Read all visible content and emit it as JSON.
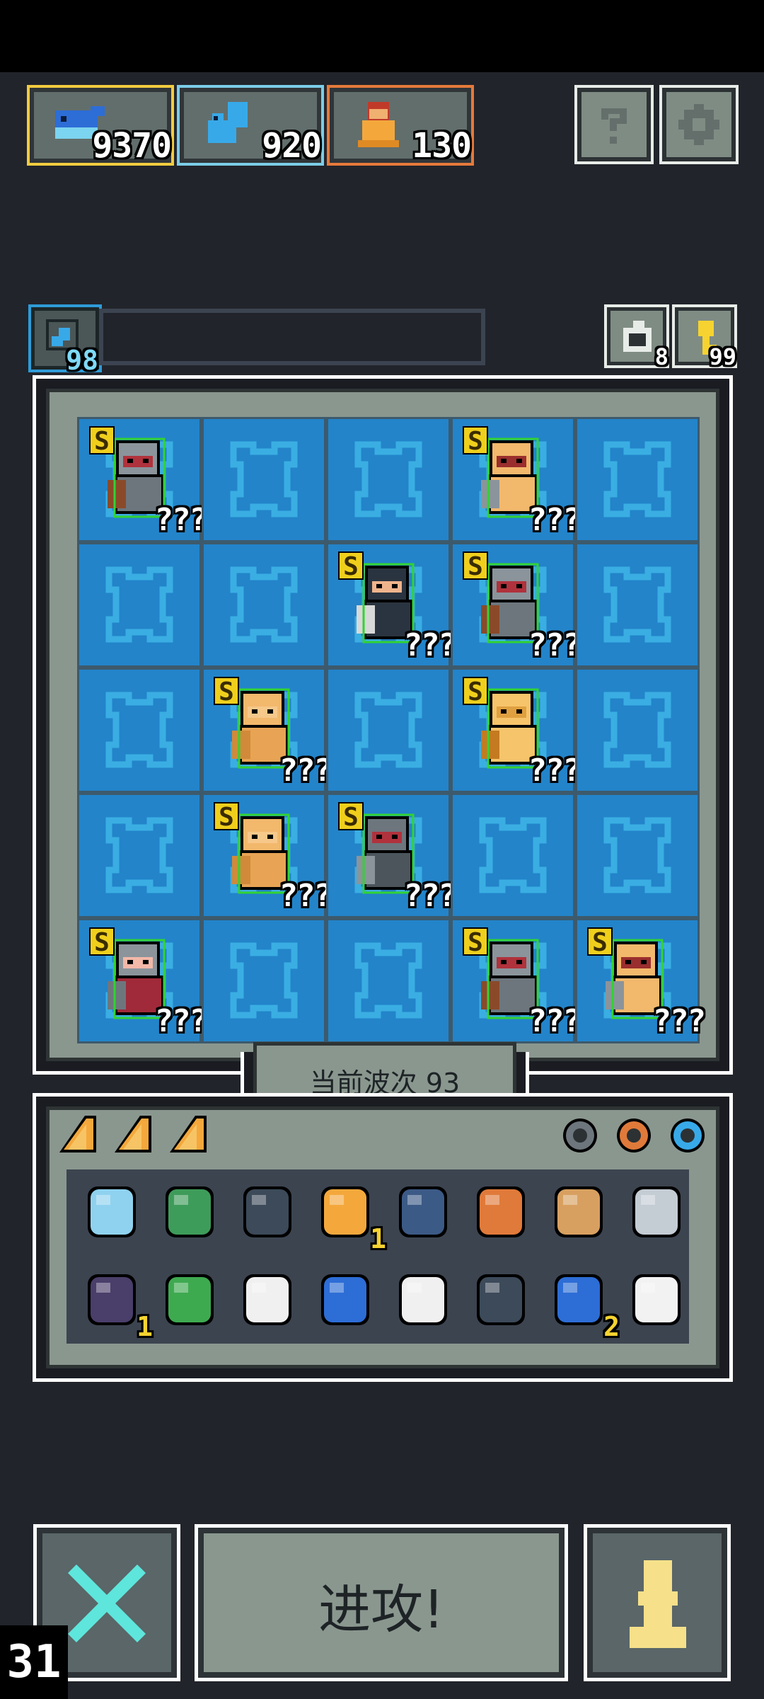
{
  "resources": [
    {
      "icon": "blue-fish-icon",
      "value": "9370",
      "border": "#f2cc40"
    },
    {
      "icon": "blue-squirrel-icon",
      "value": "920",
      "border": "#7ccde8"
    },
    {
      "icon": "orange-pawn-icon",
      "value": "130",
      "border": "#e57a3b"
    }
  ],
  "buttons": {
    "help_icon": "question-icon",
    "settings_icon": "gear-icon"
  },
  "skill": {
    "value": "98",
    "accent": "#2e9bd8"
  },
  "refresh": {
    "value": "8"
  },
  "keys": {
    "value": "99"
  },
  "board": {
    "columns": 5,
    "rows": 5,
    "units": [
      {
        "row": 0,
        "col": 0,
        "rank": "S",
        "label": "???",
        "kind": "shield-knight-icon"
      },
      {
        "row": 0,
        "col": 3,
        "rank": "S",
        "label": "???",
        "kind": "red-scarf-warrior-icon"
      },
      {
        "row": 1,
        "col": 2,
        "rank": "S",
        "label": "???",
        "kind": "dark-hood-rogue-icon"
      },
      {
        "row": 1,
        "col": 3,
        "rank": "S",
        "label": "???",
        "kind": "shield-knight-icon"
      },
      {
        "row": 2,
        "col": 1,
        "rank": "S",
        "label": "???",
        "kind": "golden-golem-icon"
      },
      {
        "row": 2,
        "col": 3,
        "rank": "S",
        "label": "???",
        "kind": "golden-paladin-icon"
      },
      {
        "row": 3,
        "col": 1,
        "rank": "S",
        "label": "???",
        "kind": "golden-golem-icon"
      },
      {
        "row": 3,
        "col": 2,
        "rank": "S",
        "label": "???",
        "kind": "iron-knight-icon"
      },
      {
        "row": 4,
        "col": 0,
        "rank": "S",
        "label": "???",
        "kind": "spear-maiden-icon"
      },
      {
        "row": 4,
        "col": 3,
        "rank": "S",
        "label": "???",
        "kind": "shield-knight-icon"
      },
      {
        "row": 4,
        "col": 4,
        "rank": "S",
        "label": "???",
        "kind": "red-scarf-warrior-icon"
      }
    ]
  },
  "wave": {
    "label": "当前波次 93"
  },
  "inventory": {
    "cheese": [
      "cheese-icon",
      "cheese-icon",
      "cheese-icon"
    ],
    "relics": [
      "armor-relic-icon",
      "ring-relic-icon",
      "blue-ring-relic-icon"
    ],
    "items": [
      {
        "icon": "mirror-scroll-icon",
        "count": ""
      },
      {
        "icon": "turtle-shell-icon",
        "count": ""
      },
      {
        "icon": "shield-icon",
        "count": ""
      },
      {
        "icon": "orange-pawn-icon",
        "count": "1"
      },
      {
        "icon": "stone-rubble-icon",
        "count": ""
      },
      {
        "icon": "wooden-staff-icon",
        "count": ""
      },
      {
        "icon": "ship-icon",
        "count": ""
      },
      {
        "icon": "battle-axe-icon",
        "count": ""
      },
      {
        "icon": "dark-tree-icon",
        "count": "1"
      },
      {
        "icon": "grass-icon",
        "count": ""
      },
      {
        "icon": "feather-icon",
        "count": ""
      },
      {
        "icon": "potion-icon",
        "count": ""
      },
      {
        "icon": "tombstone-icon",
        "count": ""
      },
      {
        "icon": "sword-icon",
        "count": ""
      },
      {
        "icon": "blue-fish-icon",
        "count": "2"
      },
      {
        "icon": "torch-feather-icon",
        "count": ""
      }
    ]
  },
  "actions": {
    "attack_label": "进攻!",
    "cancel_icon": "cross-icon",
    "pawn_icon": "pawn-icon"
  },
  "counter": "31"
}
